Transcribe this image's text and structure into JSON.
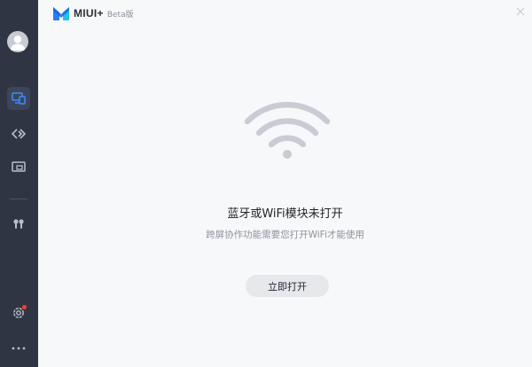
{
  "app": {
    "name": "MIUI+",
    "tag": "Beta版"
  },
  "sidebar": {
    "items": [
      {
        "name": "avatar",
        "icon": "user-icon"
      },
      {
        "name": "devices",
        "icon": "device-screens-icon",
        "active": true
      },
      {
        "name": "cross-connect",
        "icon": "chevrons-icon"
      },
      {
        "name": "screen-cast",
        "icon": "cast-screen-icon"
      },
      {
        "name": "earbuds",
        "icon": "earbuds-icon"
      },
      {
        "name": "settings",
        "icon": "gear-icon",
        "badge": true
      },
      {
        "name": "more",
        "icon": "more-dots-icon"
      }
    ]
  },
  "status": {
    "icon": "wifi-icon",
    "title": "蓝牙或WiFi模块未打开",
    "subtitle": "跨屏协作功能需要您打开WiFi才能使用",
    "button_label": "立即打开"
  },
  "colors": {
    "sidebar_bg": "#2f3543",
    "content_bg": "#f7f8fa",
    "accent": "#3d8bff",
    "wifi_gray": "#c9ccd2"
  }
}
